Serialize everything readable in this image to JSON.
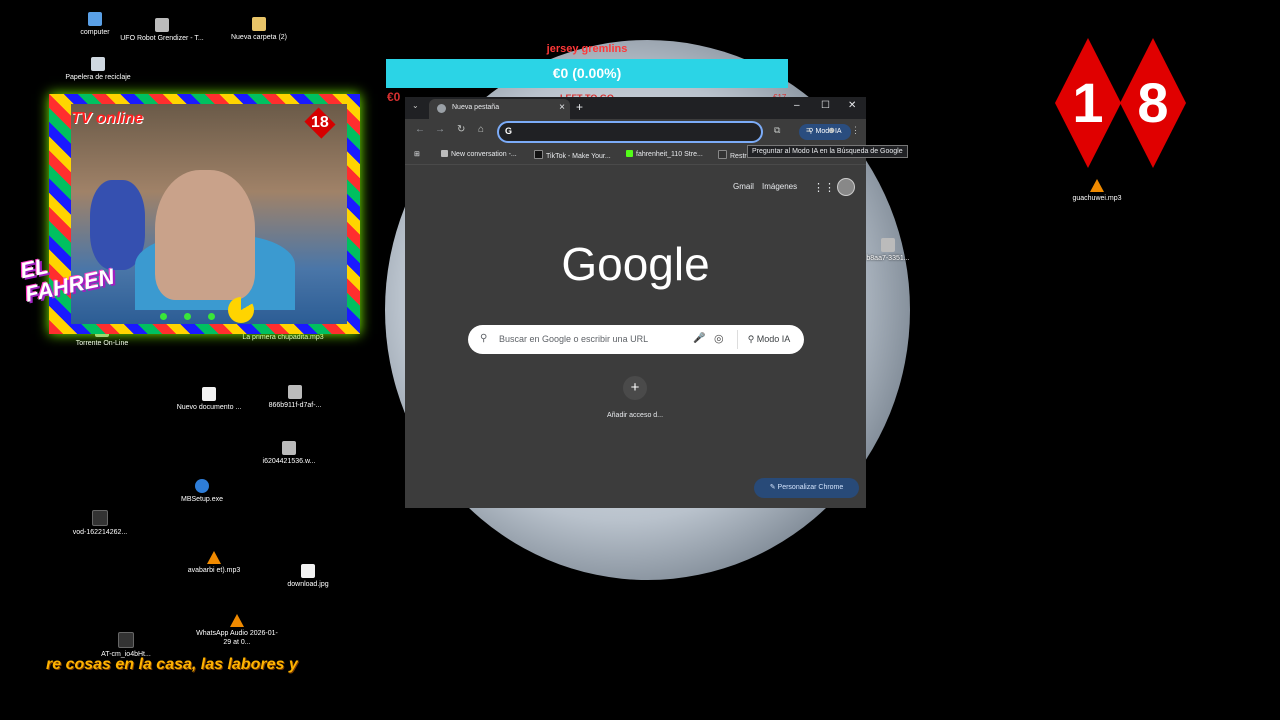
{
  "desktop": {
    "icons": [
      {
        "label": "computer",
        "kind": "pc"
      },
      {
        "label": "UFO Robot Grendizer - T...",
        "kind": "img"
      },
      {
        "label": "Nueva carpeta (2)",
        "kind": "folder"
      },
      {
        "label": "Papelera de reciclaje",
        "kind": "bin"
      },
      {
        "label": "Torrente On-Line",
        "kind": "img"
      },
      {
        "label": "La primera chupadita.mp3",
        "kind": "vlc"
      },
      {
        "label": "Nuevo documento ...",
        "kind": "file"
      },
      {
        "label": "866b911f-d7af-...",
        "kind": "img"
      },
      {
        "label": "i6204421536.w...",
        "kind": "img"
      },
      {
        "label": "MBSetup.exe",
        "kind": "setup"
      },
      {
        "label": "vod-162214262...",
        "kind": "dark"
      },
      {
        "label": "avabarbi et).mp3",
        "kind": "vlc"
      },
      {
        "label": "download.jpg",
        "kind": "file"
      },
      {
        "label": "AT-cm_io4bHt...",
        "kind": "dark"
      },
      {
        "label": "WhatsApp Audio 2026-01-29 at 0...",
        "kind": "vlc"
      },
      {
        "label": "b8aa7-3351...",
        "kind": "img"
      },
      {
        "label": "guachuwei.mp3",
        "kind": "vlc"
      }
    ]
  },
  "overlay": {
    "goal_title": "jersey gremlins",
    "goal_amount": "€0 (0.00%)",
    "goal_current": "€0",
    "goal_target": "€17",
    "goal_mid": "LEFT TO GO",
    "tv_label": "TV online",
    "cam_badge": "18",
    "streamer_logo_1": "EL",
    "streamer_logo_2": "FAHREN",
    "badge_digit_1": "1",
    "badge_digit_2": "8",
    "ticker": "re cosas en la casa, las labores y"
  },
  "browser": {
    "tab_title": "Nueva pestaña",
    "omnibox_prefix": "G",
    "ai_mode_button": "Modo IA",
    "tooltip": "Preguntar al Modo IA en la Búsqueda de Google",
    "bookmarks": [
      {
        "label": "New conversation -...",
        "color": "#bbbbbb"
      },
      {
        "label": "TikTok - Make Your...",
        "color": "#111111"
      },
      {
        "label": "fahrenheit_110 Stre...",
        "color": "#53fc18"
      },
      {
        "label": "Restr",
        "color": "#333333"
      }
    ],
    "gmail": "Gmail",
    "images": "Imágenes",
    "logo": "Google",
    "search_placeholder": "Buscar en Google o escribir una URL",
    "search_ai_mode": "Modo IA",
    "add_shortcut_label": "Añadir acceso d...",
    "customize_button": "Personalizar Chrome"
  }
}
